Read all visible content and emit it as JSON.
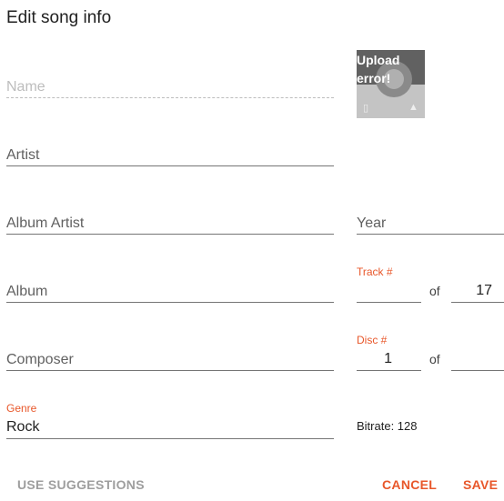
{
  "dialog": {
    "title": "Edit song info"
  },
  "fields": {
    "name": {
      "placeholder": "Name"
    },
    "artist": {
      "label": "Artist"
    },
    "album_artist": {
      "label": "Album Artist"
    },
    "year": {
      "label": "Year"
    },
    "album": {
      "label": "Album"
    },
    "track": {
      "label": "Track #",
      "value": "",
      "of_label": "of",
      "total": "17"
    },
    "composer": {
      "label": "Composer"
    },
    "disc": {
      "label": "Disc #",
      "value": "1",
      "of_label": "of",
      "total": ""
    },
    "genre": {
      "label": "Genre",
      "value": "Rock"
    }
  },
  "album_art": {
    "error_text": "Upload error!",
    "icons": [
      "delete-icon",
      "upload-icon"
    ]
  },
  "bitrate": "Bitrate: 128",
  "actions": {
    "use_suggestions": "USE SUGGESTIONS",
    "cancel": "CANCEL",
    "save": "SAVE"
  },
  "colors": {
    "accent": "#e8572a",
    "text": "#212121",
    "muted": "#9e9e9e"
  }
}
